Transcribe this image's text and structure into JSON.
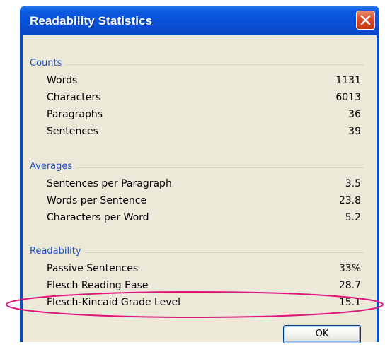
{
  "dialog": {
    "title": "Readability Statistics",
    "close_icon": "close-x-icon",
    "ok_label": "OK"
  },
  "groups": {
    "counts": {
      "title": "Counts",
      "rows": [
        {
          "label": "Words",
          "value": "1131"
        },
        {
          "label": "Characters",
          "value": "6013"
        },
        {
          "label": "Paragraphs",
          "value": "36"
        },
        {
          "label": "Sentences",
          "value": "39"
        }
      ]
    },
    "averages": {
      "title": "Averages",
      "rows": [
        {
          "label": "Sentences per Paragraph",
          "value": "3.5"
        },
        {
          "label": "Words per Sentence",
          "value": "23.8"
        },
        {
          "label": "Characters per Word",
          "value": "5.2"
        }
      ]
    },
    "readability": {
      "title": "Readability",
      "rows": [
        {
          "label": "Passive Sentences",
          "value": "33%"
        },
        {
          "label": "Flesch Reading Ease",
          "value": "28.7"
        },
        {
          "label": "Flesch-Kincaid Grade Level",
          "value": "15.1"
        }
      ]
    }
  },
  "colors": {
    "title_bar": "#0a50d6",
    "group_title": "#1e50c8",
    "dialog_background": "#ece9d8",
    "close_button": "#d84a25",
    "highlight_annotation": "#e0157a"
  }
}
